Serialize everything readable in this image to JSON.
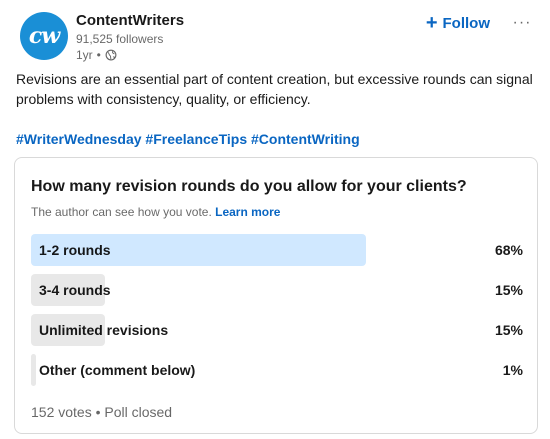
{
  "author": {
    "name": "ContentWriters",
    "followers": "91,525 followers",
    "age": "1yr",
    "separator": "•",
    "avatar_text": "cw",
    "avatar_color": "#1a8fd6",
    "visibility_icon": "globe-icon"
  },
  "actions": {
    "follow_label": "Follow",
    "follow_icon": "+",
    "more_icon": "···",
    "accent_color": "#0a66c2"
  },
  "post": {
    "text": "Revisions are an essential part of content creation, but excessive rounds can signal problems with consistency, quality, or efficiency.",
    "hashtags": [
      "#WriterWednesday",
      "#FreelanceTips",
      "#ContentWriting"
    ]
  },
  "poll": {
    "question": "How many revision rounds do you allow for your clients?",
    "note": "The author can see how you vote.",
    "learn_more": "Learn more",
    "options": [
      {
        "label": "1-2 rounds",
        "percent": "68%",
        "share": 68,
        "selected": true
      },
      {
        "label": "3-4 rounds",
        "percent": "15%",
        "share": 15,
        "selected": false
      },
      {
        "label": "Unlimited revisions",
        "percent": "15%",
        "share": 15,
        "selected": false
      },
      {
        "label": "Other (comment below)",
        "percent": "1%",
        "share": 1,
        "selected": false
      }
    ],
    "footer": "152 votes • Poll closed",
    "colors": {
      "selected_bar": "#d0e8ff",
      "default_bar": "#e8e8e8"
    }
  }
}
